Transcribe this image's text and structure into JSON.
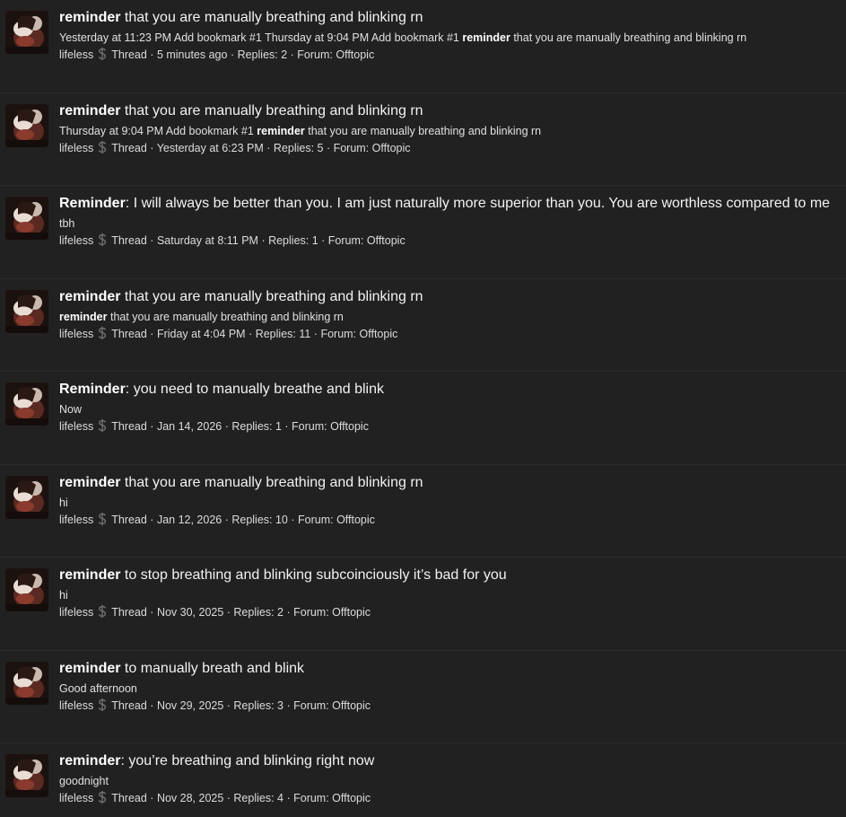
{
  "colors": {
    "background": "#212121",
    "divider": "#2c2c2c",
    "username": "#e0245e",
    "text": "#e6e6e6"
  },
  "meta_labels": {
    "type": "Thread",
    "separator": " · ",
    "replies_prefix": "Replies: ",
    "forum_prefix": "Forum: "
  },
  "results": [
    {
      "title_kw": "reminder",
      "title_rest": " that you are manually breathing and blinking rn",
      "snippet_pre": "Yesterday at 11:23 PM Add bookmark #1 Thursday at 9:04 PM Add bookmark #1 ",
      "snippet_kw": "reminder",
      "snippet_post": " that you are manually breathing and blinking rn",
      "user": "lifeless",
      "icon": "dollar-sign-icon",
      "time": "5 minutes ago",
      "replies": "2",
      "forum": "Offtopic"
    },
    {
      "title_kw": "reminder",
      "title_rest": " that you are manually breathing and blinking rn",
      "snippet_pre": "Thursday at 9:04 PM Add bookmark #1 ",
      "snippet_kw": "reminder",
      "snippet_post": " that you are manually breathing and blinking rn",
      "user": "lifeless",
      "icon": "dollar-sign-icon",
      "time": "Yesterday at 6:23 PM",
      "replies": "5",
      "forum": "Offtopic"
    },
    {
      "title_kw": "Reminder",
      "title_rest": ": I will always be better than you. I am just naturally more superior than you. You are worthless compared to me",
      "snippet_pre": "tbh",
      "snippet_kw": "",
      "snippet_post": "",
      "user": "lifeless",
      "icon": "dollar-sign-icon",
      "time": "Saturday at 8:11 PM",
      "replies": "1",
      "forum": "Offtopic"
    },
    {
      "title_kw": "reminder",
      "title_rest": " that you are manually breathing and blinking rn",
      "snippet_pre": "",
      "snippet_kw": "reminder",
      "snippet_post": " that you are manually breathing and blinking rn",
      "user": "lifeless",
      "icon": "dollar-sign-icon",
      "time": "Friday at 4:04 PM",
      "replies": "11",
      "forum": "Offtopic"
    },
    {
      "title_kw": "Reminder",
      "title_rest": ": you need to manually breathe and blink",
      "snippet_pre": "Now",
      "snippet_kw": "",
      "snippet_post": "",
      "user": "lifeless",
      "icon": "dollar-sign-icon",
      "time": "Jan 14, 2026",
      "replies": "1",
      "forum": "Offtopic"
    },
    {
      "title_kw": "reminder",
      "title_rest": " that you are manually breathing and blinking rn",
      "snippet_pre": "hi",
      "snippet_kw": "",
      "snippet_post": "",
      "user": "lifeless",
      "icon": "dollar-sign-icon",
      "time": "Jan 12, 2026",
      "replies": "10",
      "forum": "Offtopic"
    },
    {
      "title_kw": "reminder",
      "title_rest": " to stop breathing and blinking subcoinciously it’s bad for you",
      "snippet_pre": "hi",
      "snippet_kw": "",
      "snippet_post": "",
      "user": "lifeless",
      "icon": "dollar-sign-icon",
      "time": "Nov 30, 2025",
      "replies": "2",
      "forum": "Offtopic"
    },
    {
      "title_kw": "reminder",
      "title_rest": " to manually breath and blink",
      "snippet_pre": "Good afternoon",
      "snippet_kw": "",
      "snippet_post": "",
      "user": "lifeless",
      "icon": "dollar-sign-icon",
      "time": "Nov 29, 2025",
      "replies": "3",
      "forum": "Offtopic"
    },
    {
      "title_kw": "reminder",
      "title_rest": ": you’re breathing and blinking right now",
      "snippet_pre": "goodnight",
      "snippet_kw": "",
      "snippet_post": "",
      "user": "lifeless",
      "icon": "dollar-sign-icon",
      "time": "Nov 28, 2025",
      "replies": "4",
      "forum": "Offtopic"
    }
  ]
}
